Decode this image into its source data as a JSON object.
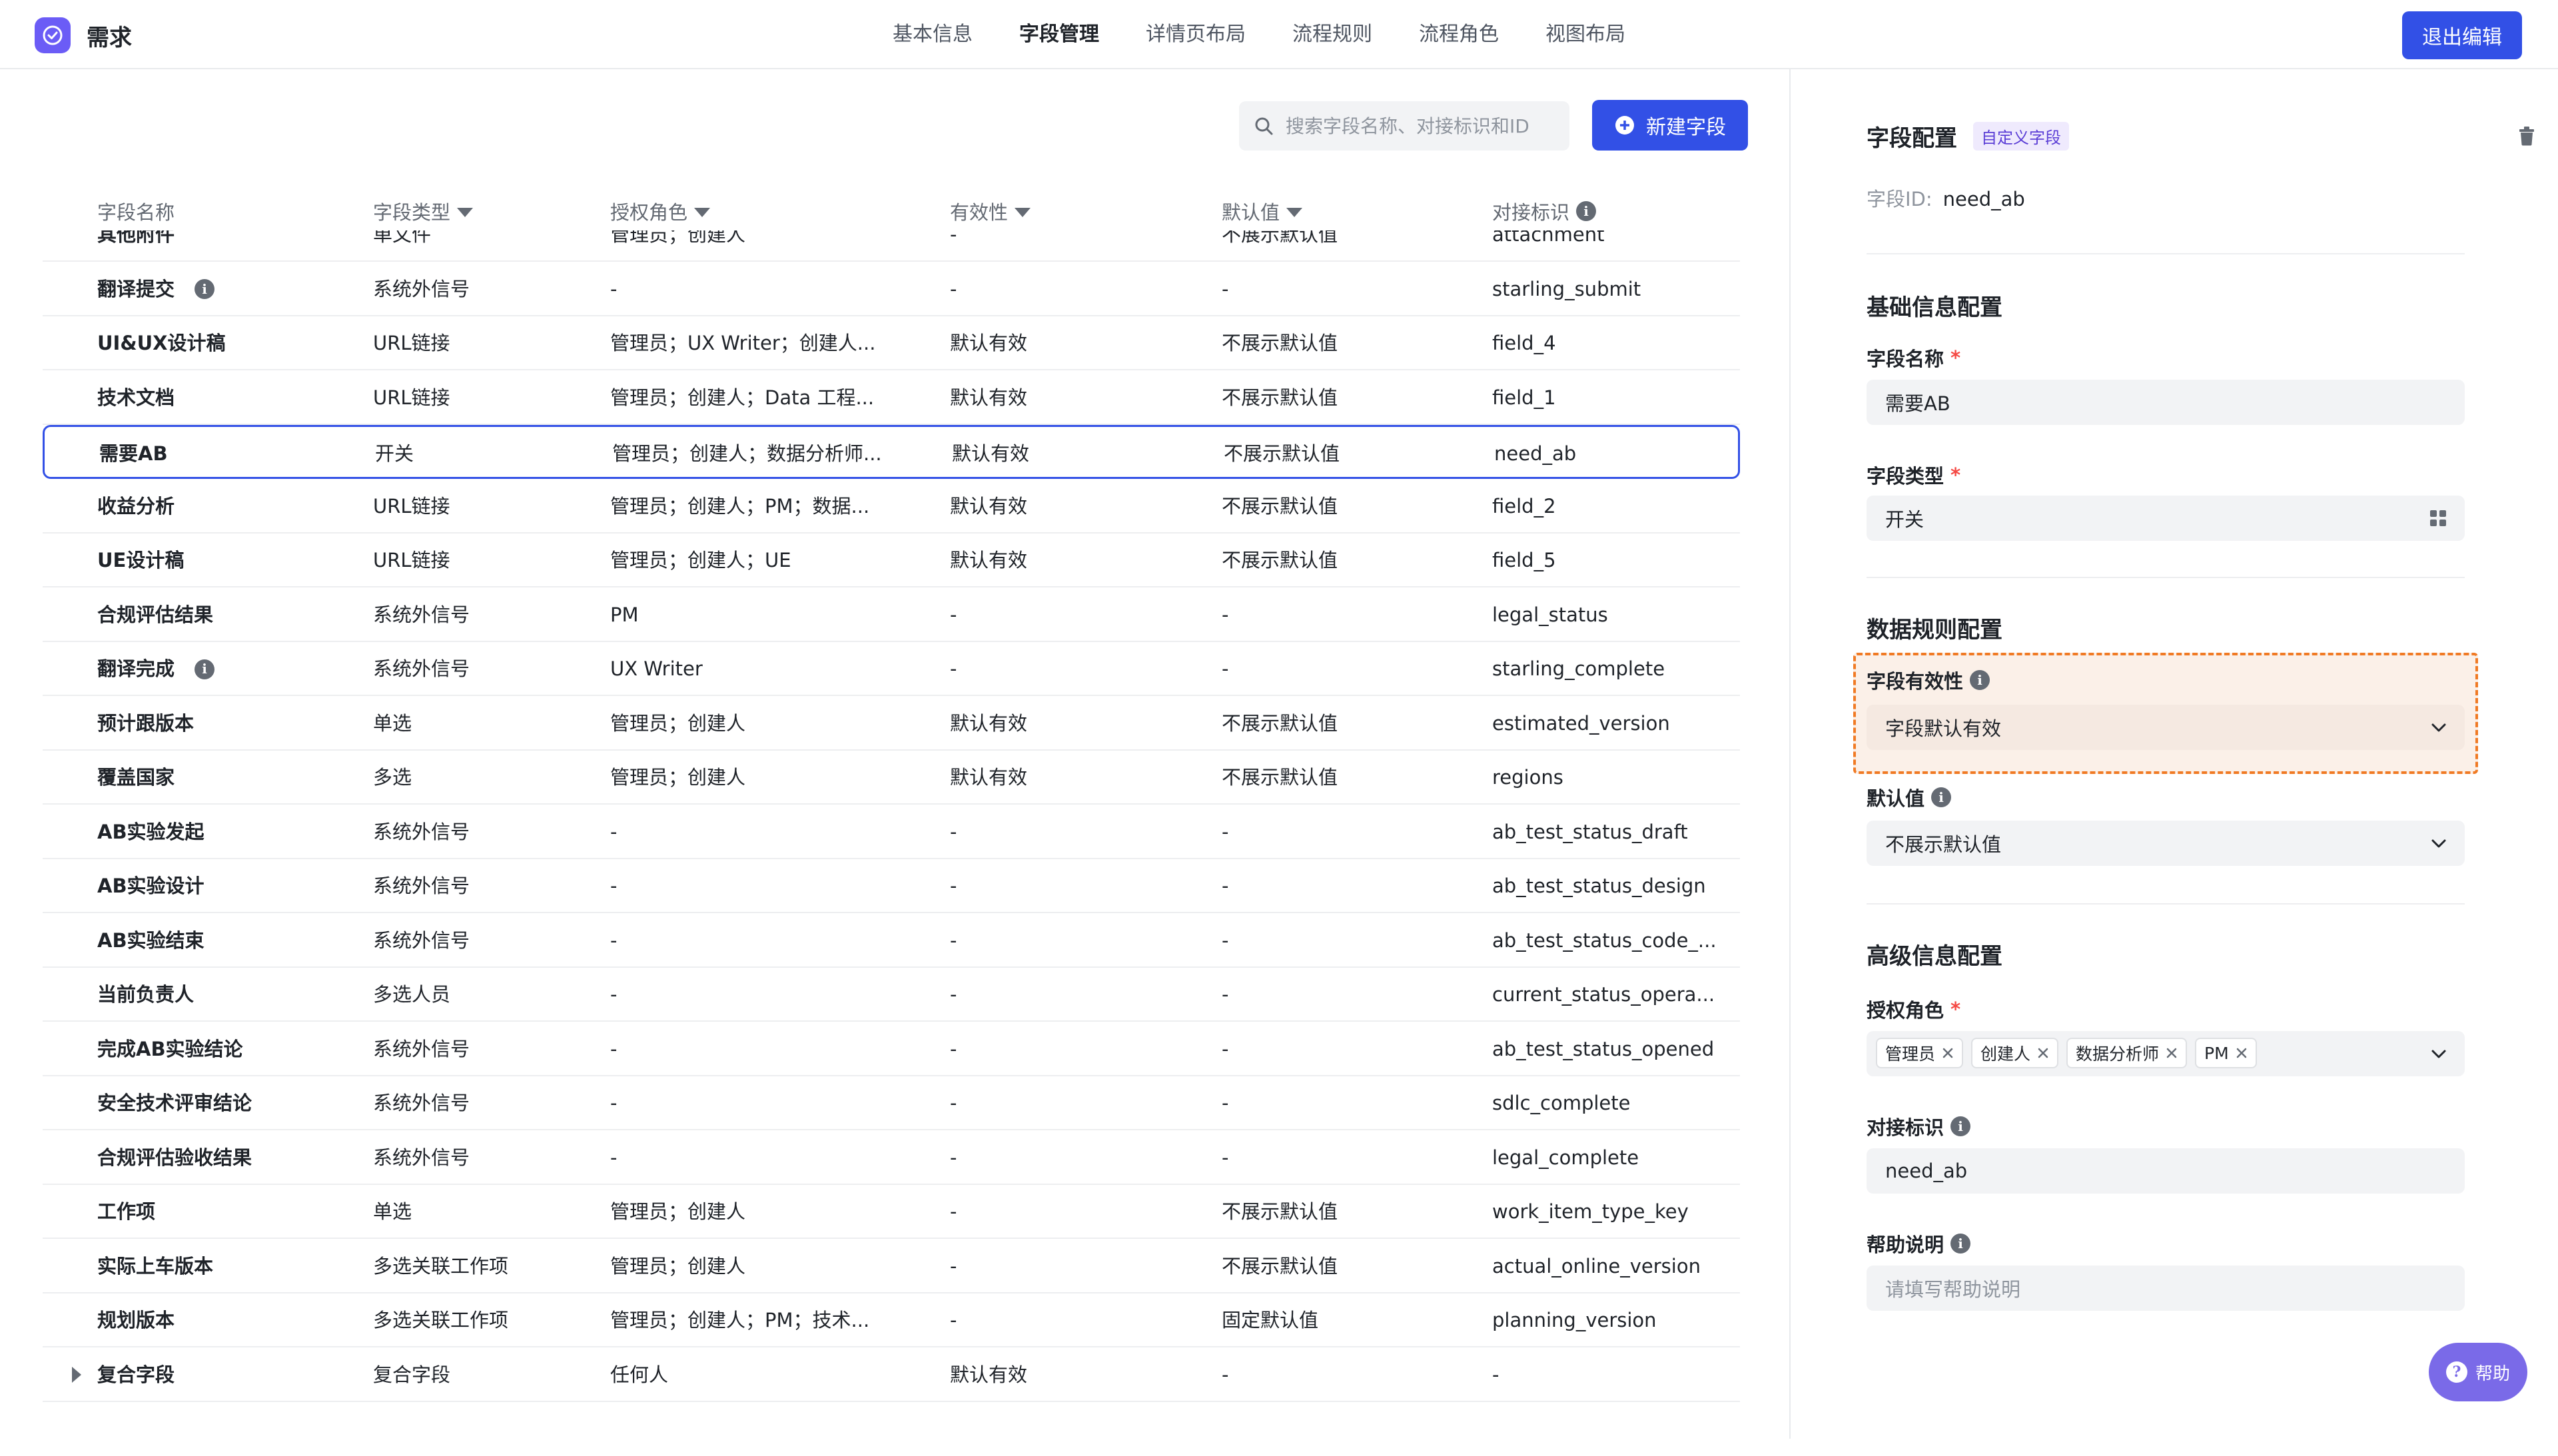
{
  "app": {
    "title": "需求",
    "brand_color": "#6b5cf6",
    "accent": "#3250e6"
  },
  "nav": {
    "items": [
      {
        "label": "基本信息",
        "active": false
      },
      {
        "label": "字段管理",
        "active": true
      },
      {
        "label": "详情页布局",
        "active": false
      },
      {
        "label": "流程规则",
        "active": false
      },
      {
        "label": "流程角色",
        "active": false
      },
      {
        "label": "视图布局",
        "active": false
      }
    ],
    "exit_label": "退出编辑"
  },
  "toolbar": {
    "search_placeholder": "搜索字段名称、对接标识和ID",
    "new_field_label": "新建字段"
  },
  "table": {
    "headers": [
      "字段名称",
      "字段类型",
      "授权角色",
      "有效性",
      "默认值",
      "对接标识"
    ],
    "filterable": [
      false,
      true,
      true,
      true,
      true,
      false
    ],
    "info_on": [
      false,
      false,
      false,
      false,
      false,
      true
    ],
    "rows": [
      {
        "name": "其他附件",
        "type": "单文件",
        "roles": "管理员；创建人",
        "validity": "-",
        "default": "不展示默认值",
        "key": "attachment"
      },
      {
        "name": "翻译提交",
        "type": "系统外信号",
        "roles": "-",
        "validity": "-",
        "default": "-",
        "key": "starling_submit",
        "info": true
      },
      {
        "name": "UI&UX设计稿",
        "type": "URL链接",
        "roles": "管理员；UX Writer；创建人...",
        "validity": "默认有效",
        "default": "不展示默认值",
        "key": "field_4"
      },
      {
        "name": "技术文档",
        "type": "URL链接",
        "roles": "管理员；创建人；Data 工程...",
        "validity": "默认有效",
        "default": "不展示默认值",
        "key": "field_1"
      },
      {
        "name": "需要AB",
        "type": "开关",
        "roles": "管理员；创建人；数据分析师...",
        "validity": "默认有效",
        "default": "不展示默认值",
        "key": "need_ab",
        "selected": true
      },
      {
        "name": "收益分析",
        "type": "URL链接",
        "roles": "管理员；创建人；PM；数据...",
        "validity": "默认有效",
        "default": "不展示默认值",
        "key": "field_2"
      },
      {
        "name": "UE设计稿",
        "type": "URL链接",
        "roles": "管理员；创建人；UE",
        "validity": "默认有效",
        "default": "不展示默认值",
        "key": "field_5"
      },
      {
        "name": "合规评估结果",
        "type": "系统外信号",
        "roles": "PM",
        "validity": "-",
        "default": "-",
        "key": "legal_status"
      },
      {
        "name": "翻译完成",
        "type": "系统外信号",
        "roles": "UX Writer",
        "validity": "-",
        "default": "-",
        "key": "starling_complete",
        "info": true
      },
      {
        "name": "预计跟版本",
        "type": "单选",
        "roles": "管理员；创建人",
        "validity": "默认有效",
        "default": "不展示默认值",
        "key": "estimated_version"
      },
      {
        "name": "覆盖国家",
        "type": "多选",
        "roles": "管理员；创建人",
        "validity": "默认有效",
        "default": "不展示默认值",
        "key": "regions"
      },
      {
        "name": "AB实验发起",
        "type": "系统外信号",
        "roles": "-",
        "validity": "-",
        "default": "-",
        "key": "ab_test_status_draft"
      },
      {
        "name": "AB实验设计",
        "type": "系统外信号",
        "roles": "-",
        "validity": "-",
        "default": "-",
        "key": "ab_test_status_design"
      },
      {
        "name": "AB实验结束",
        "type": "系统外信号",
        "roles": "-",
        "validity": "-",
        "default": "-",
        "key": "ab_test_status_code_..."
      },
      {
        "name": "当前负责人",
        "type": "多选人员",
        "roles": "-",
        "validity": "-",
        "default": "-",
        "key": "current_status_opera..."
      },
      {
        "name": "完成AB实验结论",
        "type": "系统外信号",
        "roles": "-",
        "validity": "-",
        "default": "-",
        "key": "ab_test_status_opened"
      },
      {
        "name": "安全技术评审结论",
        "type": "系统外信号",
        "roles": "-",
        "validity": "-",
        "default": "-",
        "key": "sdlc_complete"
      },
      {
        "name": "合规评估验收结果",
        "type": "系统外信号",
        "roles": "-",
        "validity": "-",
        "default": "-",
        "key": "legal_complete"
      },
      {
        "name": "工作项",
        "type": "单选",
        "roles": "管理员；创建人",
        "validity": "-",
        "default": "不展示默认值",
        "key": "work_item_type_key"
      },
      {
        "name": "实际上车版本",
        "type": "多选关联工作项",
        "roles": "管理员；创建人",
        "validity": "-",
        "default": "不展示默认值",
        "key": "actual_online_version"
      },
      {
        "name": "规划版本",
        "type": "多选关联工作项",
        "roles": "管理员；创建人；PM；技术...",
        "validity": "-",
        "default": "固定默认值",
        "key": "planning_version"
      },
      {
        "name": "复合字段",
        "type": "复合字段",
        "roles": "任何人",
        "validity": "默认有效",
        "default": "-",
        "key": "-",
        "expandable": true
      }
    ]
  },
  "panel": {
    "title": "字段配置",
    "badge": "自定义字段",
    "field_id_label": "字段ID:",
    "field_id_value": "need_ab",
    "basic_section": "基础信息配置",
    "name_label": "字段名称",
    "name_value": "需要AB",
    "type_label": "字段类型",
    "type_value": "开关",
    "rules_section": "数据规则配置",
    "validity_label": "字段有效性",
    "validity_value": "字段默认有效",
    "default_label": "默认值",
    "default_value": "不展示默认值",
    "advanced_section": "高级信息配置",
    "roles_label": "授权角色",
    "role_tags": [
      "管理员",
      "创建人",
      "数据分析师",
      "PM"
    ],
    "key_label": "对接标识",
    "key_value": "need_ab",
    "help_label": "帮助说明",
    "help_placeholder": "请填写帮助说明",
    "help_button": "帮助",
    "required_mark": "*"
  }
}
